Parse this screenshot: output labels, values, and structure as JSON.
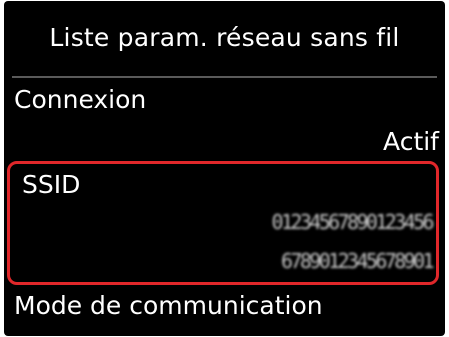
{
  "header": {
    "title": "Liste param. réseau sans fil"
  },
  "rows": {
    "connection": {
      "label": "Connexion",
      "value": "Actif"
    },
    "ssid": {
      "label": "SSID",
      "value_line1": "01234567890123456",
      "value_line2": "6789012345678901"
    },
    "mode": {
      "label": "Mode de communication"
    }
  },
  "colors": {
    "background": "#000000",
    "text": "#ffffff",
    "selection_border": "#e0272a",
    "divider": "#5a5a5a"
  }
}
